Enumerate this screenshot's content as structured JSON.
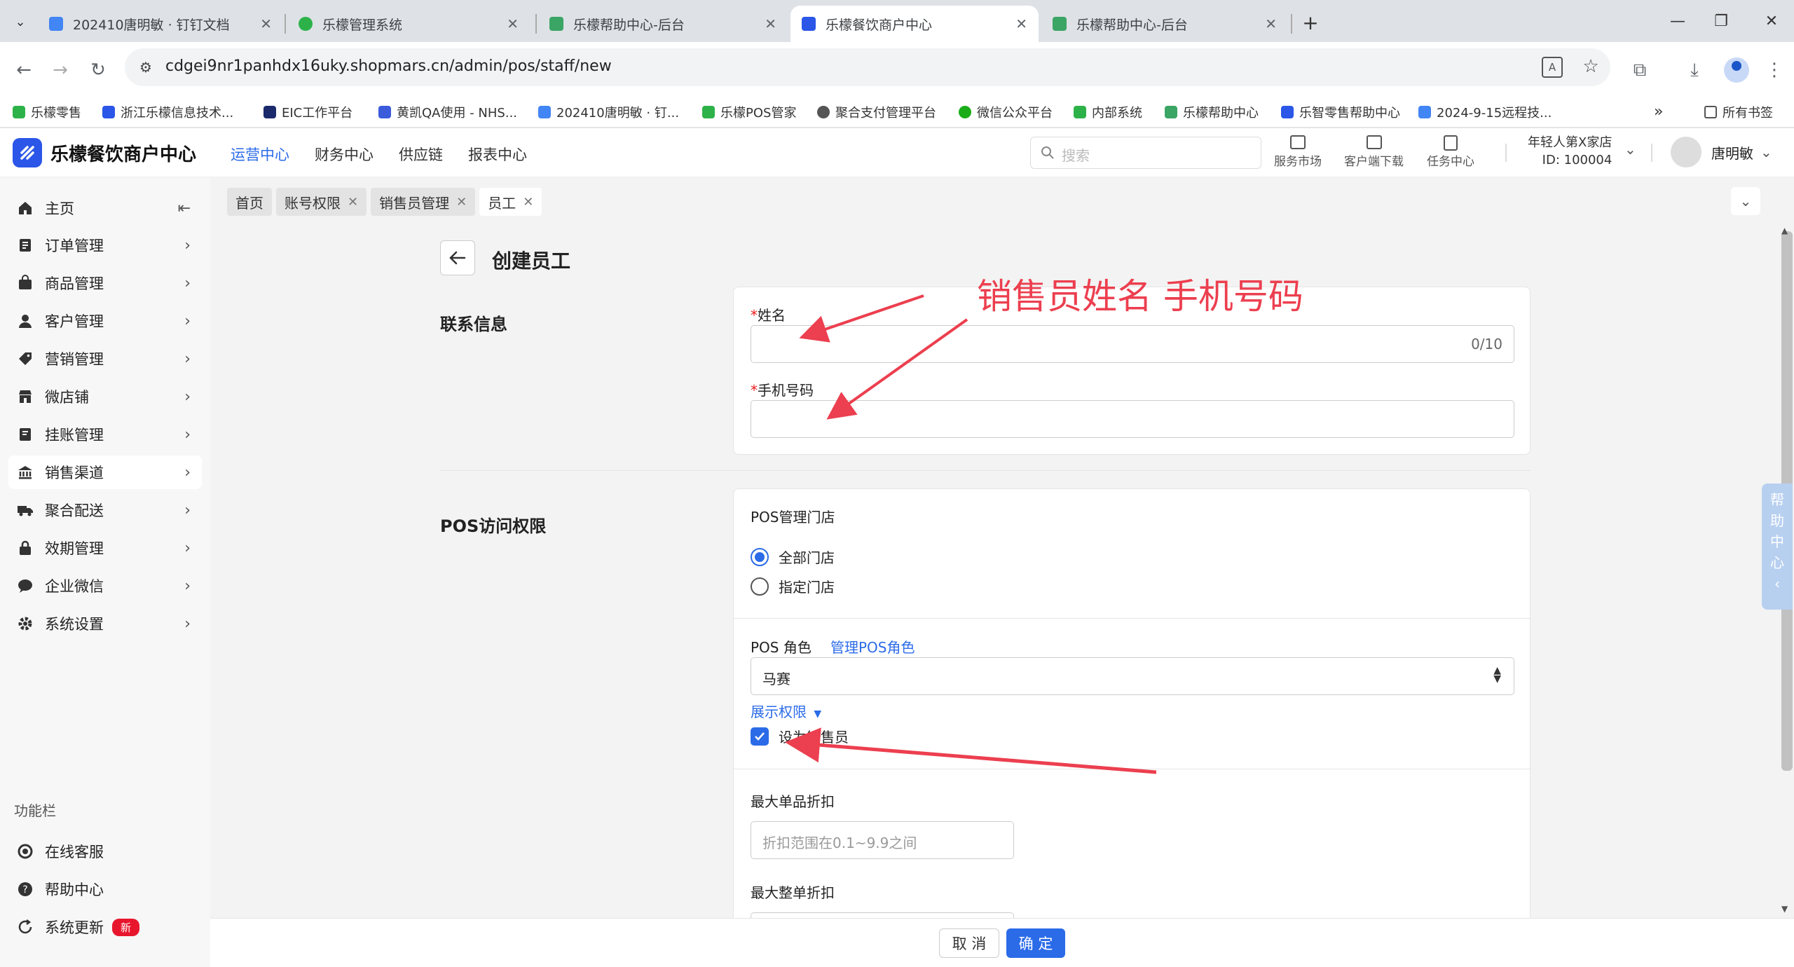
{
  "browser": {
    "tabs": [
      {
        "title": "202410唐明敏 · 钉钉文档",
        "fav": "#4285f4"
      },
      {
        "title": "乐檬管理系统",
        "fav": "#2db24a"
      },
      {
        "title": "乐檬帮助中心-后台",
        "fav": "#3aa564"
      },
      {
        "title": "乐檬餐饮商户中心",
        "fav": "#2b56e8"
      },
      {
        "title": "乐檬帮助中心-后台",
        "fav": "#3aa564"
      }
    ],
    "url": "cdgei9nr1panhdx16uky.shopmars.cn/admin/pos/staff/new",
    "bookmarks": [
      {
        "label": "乐檬零售",
        "color": "#2db24a"
      },
      {
        "label": "浙江乐檬信息技术...",
        "color": "#2b56e8"
      },
      {
        "label": "EIC工作平台",
        "color": "#1b2a6b"
      },
      {
        "label": "黄凯QA使用 - NHS...",
        "color": "#3b5bdb"
      },
      {
        "label": "202410唐明敏 · 钉...",
        "color": "#4285f4"
      },
      {
        "label": "乐檬POS管家",
        "color": "#2db24a"
      },
      {
        "label": "聚合支付管理平台",
        "color": "#555"
      },
      {
        "label": "微信公众平台",
        "color": "#1aad19"
      },
      {
        "label": "内部系统",
        "color": "#2db24a"
      },
      {
        "label": "乐檬帮助中心",
        "color": "#3aa564"
      },
      {
        "label": "乐智零售帮助中心",
        "color": "#2b56e8"
      },
      {
        "label": "2024-9-15远程技...",
        "color": "#4285f4"
      }
    ],
    "all_bookmarks": "所有书签"
  },
  "header": {
    "logo_text": "乐檬餐饮商户中心",
    "nav": [
      "运营中心",
      "财务中心",
      "供应链",
      "报表中心"
    ],
    "search_placeholder": "搜索",
    "buttons": [
      "服务市场",
      "客户端下载",
      "任务中心"
    ],
    "store_name": "年轻人第X家店",
    "store_id": "ID: 100004",
    "username": "唐明敏"
  },
  "sidebar": {
    "items": [
      {
        "label": "主页"
      },
      {
        "label": "订单管理"
      },
      {
        "label": "商品管理"
      },
      {
        "label": "客户管理"
      },
      {
        "label": "营销管理"
      },
      {
        "label": "微店铺"
      },
      {
        "label": "挂账管理"
      },
      {
        "label": "销售渠道"
      },
      {
        "label": "聚合配送"
      },
      {
        "label": "效期管理"
      },
      {
        "label": "企业微信"
      },
      {
        "label": "系统设置"
      }
    ],
    "func_title": "功能栏",
    "func_items": [
      "在线客服",
      "帮助中心",
      "系统更新"
    ],
    "new_badge": "新"
  },
  "breadcrumbs": [
    "首页",
    "账号权限",
    "销售员管理",
    "员工"
  ],
  "page": {
    "title": "创建员工",
    "contact_section": "联系信息",
    "name_label": "姓名",
    "name_counter": "0/10",
    "phone_label": "手机号码",
    "pos_section": "POS访问权限",
    "store_label": "POS管理门店",
    "store_options": [
      "全部门店",
      "指定门店"
    ],
    "role_label": "POS 角色",
    "manage_role_link": "管理POS角色",
    "role_value": "马赛",
    "show_perm_link": "展示权限",
    "salesperson_label": "设为销售员",
    "max_item_discount_label": "最大单品折扣",
    "max_item_discount_placeholder": "折扣范围在0.1~9.9之间",
    "max_order_discount_label": "最大整单折扣"
  },
  "footer": {
    "cancel": "取 消",
    "confirm": "确 定"
  },
  "help_side": [
    "帮",
    "助",
    "中",
    "心"
  ],
  "annotation": "销售员姓名 手机号码",
  "colors": {
    "primary": "#2b6be8",
    "annotation": "#ec3f4f"
  }
}
